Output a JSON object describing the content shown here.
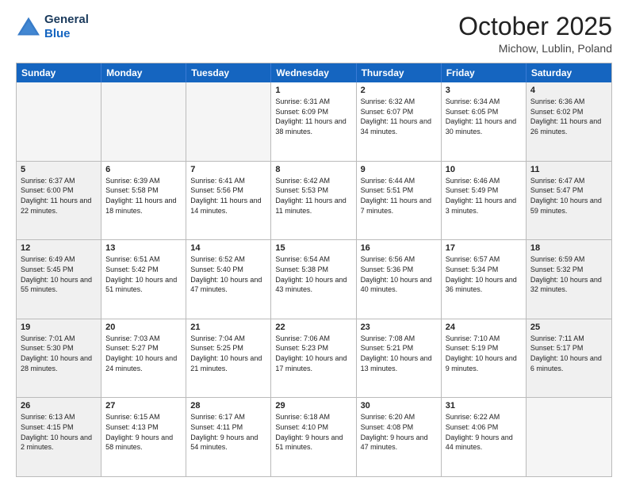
{
  "logo": {
    "line1": "General",
    "line2": "Blue"
  },
  "title": "October 2025",
  "location": "Michow, Lublin, Poland",
  "days_of_week": [
    "Sunday",
    "Monday",
    "Tuesday",
    "Wednesday",
    "Thursday",
    "Friday",
    "Saturday"
  ],
  "weeks": [
    [
      {
        "day": "",
        "empty": true
      },
      {
        "day": "",
        "empty": true
      },
      {
        "day": "",
        "empty": true
      },
      {
        "day": "1",
        "sunrise": "6:31 AM",
        "sunset": "6:09 PM",
        "daylight": "11 hours and 38 minutes."
      },
      {
        "day": "2",
        "sunrise": "6:32 AM",
        "sunset": "6:07 PM",
        "daylight": "11 hours and 34 minutes."
      },
      {
        "day": "3",
        "sunrise": "6:34 AM",
        "sunset": "6:05 PM",
        "daylight": "11 hours and 30 minutes."
      },
      {
        "day": "4",
        "sunrise": "6:36 AM",
        "sunset": "6:02 PM",
        "daylight": "11 hours and 26 minutes."
      }
    ],
    [
      {
        "day": "5",
        "sunrise": "6:37 AM",
        "sunset": "6:00 PM",
        "daylight": "11 hours and 22 minutes."
      },
      {
        "day": "6",
        "sunrise": "6:39 AM",
        "sunset": "5:58 PM",
        "daylight": "11 hours and 18 minutes."
      },
      {
        "day": "7",
        "sunrise": "6:41 AM",
        "sunset": "5:56 PM",
        "daylight": "11 hours and 14 minutes."
      },
      {
        "day": "8",
        "sunrise": "6:42 AM",
        "sunset": "5:53 PM",
        "daylight": "11 hours and 11 minutes."
      },
      {
        "day": "9",
        "sunrise": "6:44 AM",
        "sunset": "5:51 PM",
        "daylight": "11 hours and 7 minutes."
      },
      {
        "day": "10",
        "sunrise": "6:46 AM",
        "sunset": "5:49 PM",
        "daylight": "11 hours and 3 minutes."
      },
      {
        "day": "11",
        "sunrise": "6:47 AM",
        "sunset": "5:47 PM",
        "daylight": "10 hours and 59 minutes."
      }
    ],
    [
      {
        "day": "12",
        "sunrise": "6:49 AM",
        "sunset": "5:45 PM",
        "daylight": "10 hours and 55 minutes."
      },
      {
        "day": "13",
        "sunrise": "6:51 AM",
        "sunset": "5:42 PM",
        "daylight": "10 hours and 51 minutes."
      },
      {
        "day": "14",
        "sunrise": "6:52 AM",
        "sunset": "5:40 PM",
        "daylight": "10 hours and 47 minutes."
      },
      {
        "day": "15",
        "sunrise": "6:54 AM",
        "sunset": "5:38 PM",
        "daylight": "10 hours and 43 minutes."
      },
      {
        "day": "16",
        "sunrise": "6:56 AM",
        "sunset": "5:36 PM",
        "daylight": "10 hours and 40 minutes."
      },
      {
        "day": "17",
        "sunrise": "6:57 AM",
        "sunset": "5:34 PM",
        "daylight": "10 hours and 36 minutes."
      },
      {
        "day": "18",
        "sunrise": "6:59 AM",
        "sunset": "5:32 PM",
        "daylight": "10 hours and 32 minutes."
      }
    ],
    [
      {
        "day": "19",
        "sunrise": "7:01 AM",
        "sunset": "5:30 PM",
        "daylight": "10 hours and 28 minutes."
      },
      {
        "day": "20",
        "sunrise": "7:03 AM",
        "sunset": "5:27 PM",
        "daylight": "10 hours and 24 minutes."
      },
      {
        "day": "21",
        "sunrise": "7:04 AM",
        "sunset": "5:25 PM",
        "daylight": "10 hours and 21 minutes."
      },
      {
        "day": "22",
        "sunrise": "7:06 AM",
        "sunset": "5:23 PM",
        "daylight": "10 hours and 17 minutes."
      },
      {
        "day": "23",
        "sunrise": "7:08 AM",
        "sunset": "5:21 PM",
        "daylight": "10 hours and 13 minutes."
      },
      {
        "day": "24",
        "sunrise": "7:10 AM",
        "sunset": "5:19 PM",
        "daylight": "10 hours and 9 minutes."
      },
      {
        "day": "25",
        "sunrise": "7:11 AM",
        "sunset": "5:17 PM",
        "daylight": "10 hours and 6 minutes."
      }
    ],
    [
      {
        "day": "26",
        "sunrise": "6:13 AM",
        "sunset": "4:15 PM",
        "daylight": "10 hours and 2 minutes."
      },
      {
        "day": "27",
        "sunrise": "6:15 AM",
        "sunset": "4:13 PM",
        "daylight": "9 hours and 58 minutes."
      },
      {
        "day": "28",
        "sunrise": "6:17 AM",
        "sunset": "4:11 PM",
        "daylight": "9 hours and 54 minutes."
      },
      {
        "day": "29",
        "sunrise": "6:18 AM",
        "sunset": "4:10 PM",
        "daylight": "9 hours and 51 minutes."
      },
      {
        "day": "30",
        "sunrise": "6:20 AM",
        "sunset": "4:08 PM",
        "daylight": "9 hours and 47 minutes."
      },
      {
        "day": "31",
        "sunrise": "6:22 AM",
        "sunset": "4:06 PM",
        "daylight": "9 hours and 44 minutes."
      },
      {
        "day": "",
        "empty": true
      }
    ]
  ]
}
